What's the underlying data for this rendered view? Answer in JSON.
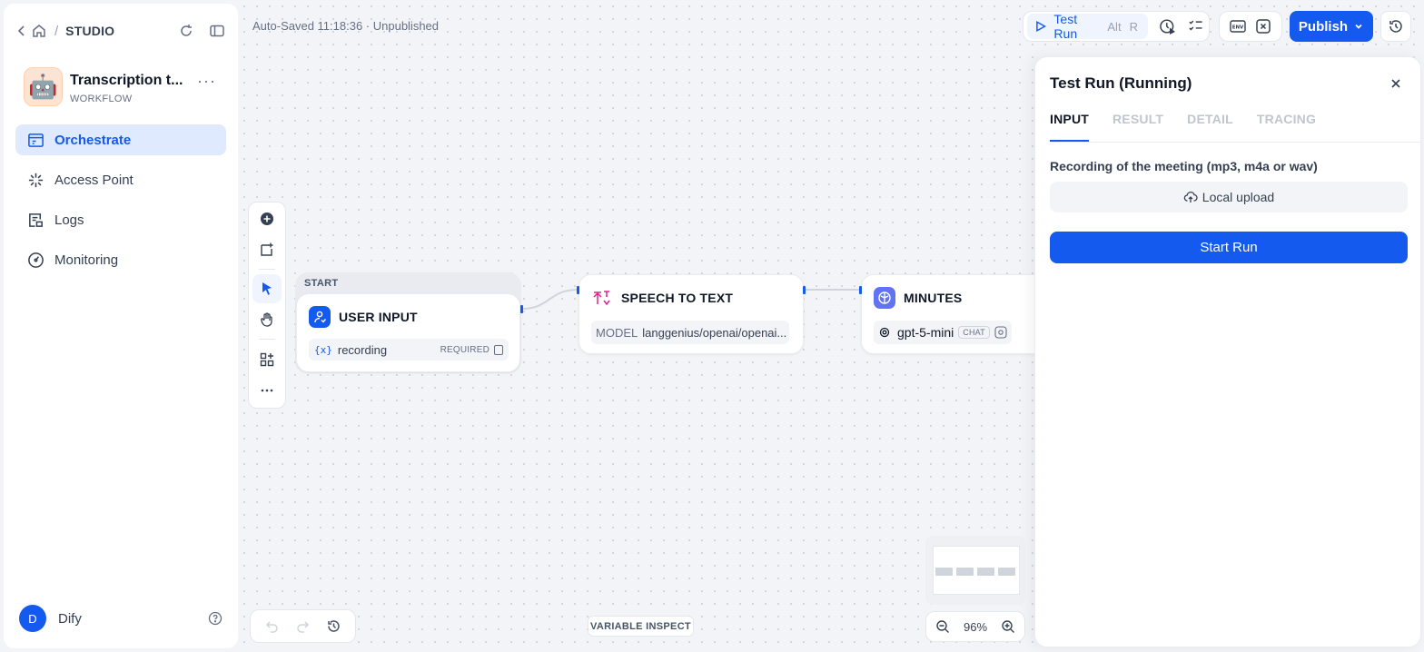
{
  "header": {
    "studio_label": "STUDIO",
    "autosave": "Auto-Saved 11:18:36 · Unpublished",
    "test_run_label": "Test Run",
    "shortcut_alt": "Alt",
    "shortcut_key": "R",
    "env_label": "ENV",
    "publish_label": "Publish"
  },
  "app": {
    "name": "Transcription t...",
    "type": "WORKFLOW",
    "icon": "robot-emoji"
  },
  "sidebar": {
    "items": [
      {
        "label": "Orchestrate",
        "icon": "orchestrate-icon",
        "active": true
      },
      {
        "label": "Access Point",
        "icon": "access-point-icon",
        "active": false
      },
      {
        "label": "Logs",
        "icon": "logs-icon",
        "active": false
      },
      {
        "label": "Monitoring",
        "icon": "monitoring-icon",
        "active": false
      }
    ],
    "user": {
      "initial": "D",
      "name": "Dify"
    }
  },
  "workflow": {
    "start_label": "START",
    "nodes": [
      {
        "title": "USER INPUT",
        "variable": "recording",
        "var_prefix": "{x}",
        "required": "REQUIRED"
      },
      {
        "title": "SPEECH TO TEXT",
        "model_key": "MODEL",
        "model_value": "langgenius/openai/openai..."
      },
      {
        "title": "MINUTES",
        "model_value": "gpt-5-mini",
        "chip": "CHAT"
      }
    ],
    "zoom": "96%",
    "variable_inspect": "VARIABLE INSPECT"
  },
  "test_run": {
    "title": "Test Run (Running)",
    "tabs": [
      "INPUT",
      "RESULT",
      "DETAIL",
      "TRACING"
    ],
    "active_tab": "INPUT",
    "field_label": "Recording of the meeting (mp3, m4a or wav)",
    "upload_label": "Local upload",
    "start_label": "Start Run"
  },
  "colors": {
    "accent": "#155aef",
    "active_bg": "#e0eaff",
    "stt_icon": "#dd2590",
    "llm_icon": "#6172f3"
  }
}
